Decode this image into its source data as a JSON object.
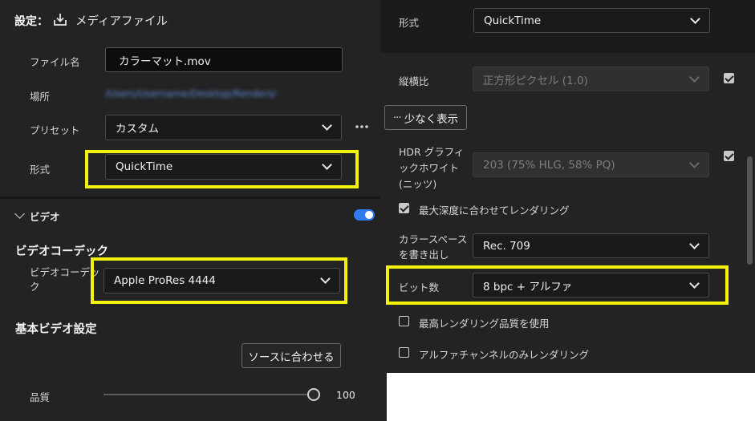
{
  "header": {
    "settings_label": "設定：",
    "icon": "download-icon",
    "title": "メディアファイル"
  },
  "left": {
    "filename": {
      "label": "ファイル名",
      "value": "カラーマット.mov"
    },
    "location": {
      "label": "場所",
      "value": "/Users/Username/Desktop/Renders/"
    },
    "preset": {
      "label": "プリセット",
      "value": "カスタム",
      "more_icon": "more-icon"
    },
    "format": {
      "label": "形式",
      "value": "QuickTime"
    },
    "video": {
      "label": "ビデオ"
    },
    "codec_section": "ビデオコーデック",
    "codec": {
      "label": "ビデオコーデック",
      "value": "Apple ProRes 4444"
    },
    "basic_section": "基本ビデオ設定",
    "match_source": "ソースに合わせる",
    "quality": {
      "label": "品質",
      "value": "100",
      "level": 100
    }
  },
  "right": {
    "format": {
      "label": "形式",
      "value": "QuickTime"
    },
    "aspect": {
      "label": "縦横比",
      "value": "正方形ピクセル (1.0)"
    },
    "show_less": "少なく表示",
    "hdr": {
      "label": "HDR グラフィックホワイト (ニッツ)",
      "value": "203 (75% HLG, 58% PQ)"
    },
    "max_depth": "最大深度に合わせてレンダリング",
    "colorspace": {
      "label": "カラースペースを書き出し",
      "value": "Rec. 709"
    },
    "bit_depth": {
      "label": "ビット数",
      "value": "8 bpc + アルファ"
    },
    "max_quality": "最高レンダリング品質を使用",
    "alpha_only": "アルファチャンネルのみレンダリング"
  },
  "colors": {
    "highlight": "#f2f20a",
    "toggle": "#2f7bf2",
    "panel": "#232323"
  }
}
